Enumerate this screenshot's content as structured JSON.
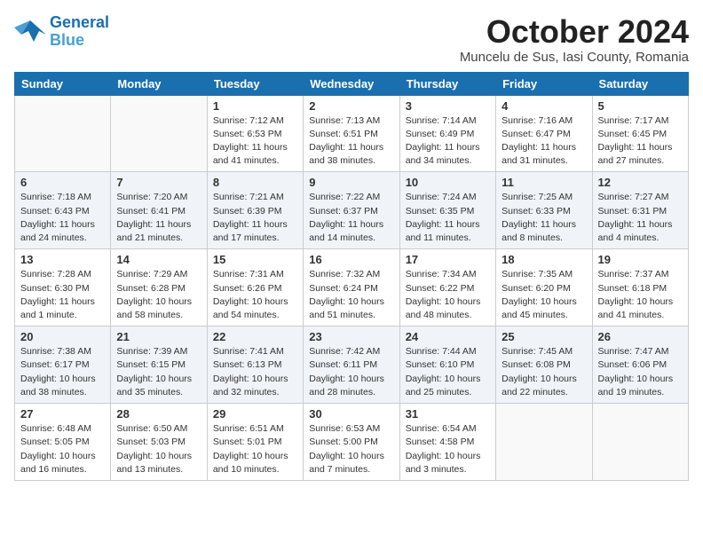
{
  "logo": {
    "line1": "General",
    "line2": "Blue"
  },
  "title": "October 2024",
  "subtitle": "Muncelu de Sus, Iasi County, Romania",
  "headers": [
    "Sunday",
    "Monday",
    "Tuesday",
    "Wednesday",
    "Thursday",
    "Friday",
    "Saturday"
  ],
  "weeks": [
    [
      {
        "day": "",
        "info": ""
      },
      {
        "day": "",
        "info": ""
      },
      {
        "day": "1",
        "info": "Sunrise: 7:12 AM\nSunset: 6:53 PM\nDaylight: 11 hours and 41 minutes."
      },
      {
        "day": "2",
        "info": "Sunrise: 7:13 AM\nSunset: 6:51 PM\nDaylight: 11 hours and 38 minutes."
      },
      {
        "day": "3",
        "info": "Sunrise: 7:14 AM\nSunset: 6:49 PM\nDaylight: 11 hours and 34 minutes."
      },
      {
        "day": "4",
        "info": "Sunrise: 7:16 AM\nSunset: 6:47 PM\nDaylight: 11 hours and 31 minutes."
      },
      {
        "day": "5",
        "info": "Sunrise: 7:17 AM\nSunset: 6:45 PM\nDaylight: 11 hours and 27 minutes."
      }
    ],
    [
      {
        "day": "6",
        "info": "Sunrise: 7:18 AM\nSunset: 6:43 PM\nDaylight: 11 hours and 24 minutes."
      },
      {
        "day": "7",
        "info": "Sunrise: 7:20 AM\nSunset: 6:41 PM\nDaylight: 11 hours and 21 minutes."
      },
      {
        "day": "8",
        "info": "Sunrise: 7:21 AM\nSunset: 6:39 PM\nDaylight: 11 hours and 17 minutes."
      },
      {
        "day": "9",
        "info": "Sunrise: 7:22 AM\nSunset: 6:37 PM\nDaylight: 11 hours and 14 minutes."
      },
      {
        "day": "10",
        "info": "Sunrise: 7:24 AM\nSunset: 6:35 PM\nDaylight: 11 hours and 11 minutes."
      },
      {
        "day": "11",
        "info": "Sunrise: 7:25 AM\nSunset: 6:33 PM\nDaylight: 11 hours and 8 minutes."
      },
      {
        "day": "12",
        "info": "Sunrise: 7:27 AM\nSunset: 6:31 PM\nDaylight: 11 hours and 4 minutes."
      }
    ],
    [
      {
        "day": "13",
        "info": "Sunrise: 7:28 AM\nSunset: 6:30 PM\nDaylight: 11 hours and 1 minute."
      },
      {
        "day": "14",
        "info": "Sunrise: 7:29 AM\nSunset: 6:28 PM\nDaylight: 10 hours and 58 minutes."
      },
      {
        "day": "15",
        "info": "Sunrise: 7:31 AM\nSunset: 6:26 PM\nDaylight: 10 hours and 54 minutes."
      },
      {
        "day": "16",
        "info": "Sunrise: 7:32 AM\nSunset: 6:24 PM\nDaylight: 10 hours and 51 minutes."
      },
      {
        "day": "17",
        "info": "Sunrise: 7:34 AM\nSunset: 6:22 PM\nDaylight: 10 hours and 48 minutes."
      },
      {
        "day": "18",
        "info": "Sunrise: 7:35 AM\nSunset: 6:20 PM\nDaylight: 10 hours and 45 minutes."
      },
      {
        "day": "19",
        "info": "Sunrise: 7:37 AM\nSunset: 6:18 PM\nDaylight: 10 hours and 41 minutes."
      }
    ],
    [
      {
        "day": "20",
        "info": "Sunrise: 7:38 AM\nSunset: 6:17 PM\nDaylight: 10 hours and 38 minutes."
      },
      {
        "day": "21",
        "info": "Sunrise: 7:39 AM\nSunset: 6:15 PM\nDaylight: 10 hours and 35 minutes."
      },
      {
        "day": "22",
        "info": "Sunrise: 7:41 AM\nSunset: 6:13 PM\nDaylight: 10 hours and 32 minutes."
      },
      {
        "day": "23",
        "info": "Sunrise: 7:42 AM\nSunset: 6:11 PM\nDaylight: 10 hours and 28 minutes."
      },
      {
        "day": "24",
        "info": "Sunrise: 7:44 AM\nSunset: 6:10 PM\nDaylight: 10 hours and 25 minutes."
      },
      {
        "day": "25",
        "info": "Sunrise: 7:45 AM\nSunset: 6:08 PM\nDaylight: 10 hours and 22 minutes."
      },
      {
        "day": "26",
        "info": "Sunrise: 7:47 AM\nSunset: 6:06 PM\nDaylight: 10 hours and 19 minutes."
      }
    ],
    [
      {
        "day": "27",
        "info": "Sunrise: 6:48 AM\nSunset: 5:05 PM\nDaylight: 10 hours and 16 minutes."
      },
      {
        "day": "28",
        "info": "Sunrise: 6:50 AM\nSunset: 5:03 PM\nDaylight: 10 hours and 13 minutes."
      },
      {
        "day": "29",
        "info": "Sunrise: 6:51 AM\nSunset: 5:01 PM\nDaylight: 10 hours and 10 minutes."
      },
      {
        "day": "30",
        "info": "Sunrise: 6:53 AM\nSunset: 5:00 PM\nDaylight: 10 hours and 7 minutes."
      },
      {
        "day": "31",
        "info": "Sunrise: 6:54 AM\nSunset: 4:58 PM\nDaylight: 10 hours and 3 minutes."
      },
      {
        "day": "",
        "info": ""
      },
      {
        "day": "",
        "info": ""
      }
    ]
  ]
}
